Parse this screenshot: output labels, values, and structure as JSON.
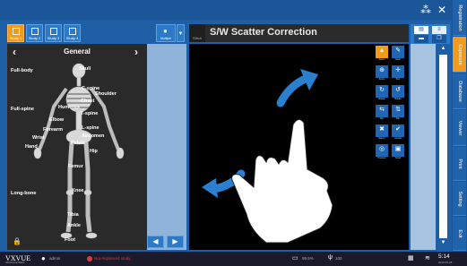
{
  "study_tabs": [
    "Study 1",
    "Study 2",
    "Study 3",
    "Study 4"
  ],
  "user_button": "Multiple",
  "bodymap": {
    "title": "General",
    "labels": [
      {
        "text": "Skull",
        "name": "skull"
      },
      {
        "text": "Full-body",
        "name": "full-body"
      },
      {
        "text": "C-spine",
        "name": "c-spine"
      },
      {
        "text": "Shoulder",
        "name": "shoulder"
      },
      {
        "text": "Chest",
        "name": "chest"
      },
      {
        "text": "Full-spine",
        "name": "full-spine"
      },
      {
        "text": "Humerus",
        "name": "humerus"
      },
      {
        "text": "T-spine",
        "name": "t-spine"
      },
      {
        "text": "Elbow",
        "name": "elbow"
      },
      {
        "text": "Forearm",
        "name": "forearm"
      },
      {
        "text": "L-spine",
        "name": "l-spine"
      },
      {
        "text": "Wrist",
        "name": "wrist"
      },
      {
        "text": "Abdomen",
        "name": "abdomen"
      },
      {
        "text": "Hand",
        "name": "hand"
      },
      {
        "text": "Pelvis",
        "name": "pelvis"
      },
      {
        "text": "Hip",
        "name": "hip"
      },
      {
        "text": "Femur",
        "name": "femur"
      },
      {
        "text": "Long-bone",
        "name": "long-bone"
      },
      {
        "text": "Knee",
        "name": "knee"
      },
      {
        "text": "Tibia",
        "name": "tibia"
      },
      {
        "text": "Ankle",
        "name": "ankle"
      },
      {
        "text": "Foot",
        "name": "foot"
      }
    ]
  },
  "viewer": {
    "title": "S/W Scatter Correction",
    "icon_label": "Stitch"
  },
  "tools": [
    {
      "label": "Select",
      "glyph": "▲",
      "active": true
    },
    {
      "label": "Mark",
      "glyph": "✎",
      "active": false
    },
    {
      "label": "Zoom",
      "glyph": "⊕",
      "active": false
    },
    {
      "label": "Pan",
      "glyph": "✛",
      "active": false
    },
    {
      "label": "Rotate",
      "glyph": "↻",
      "active": false
    },
    {
      "label": "Rotate",
      "glyph": "↺",
      "active": false
    },
    {
      "label": "Flip",
      "glyph": "⇆",
      "active": false
    },
    {
      "label": "Flip",
      "glyph": "⇅",
      "active": false
    },
    {
      "label": "Reject",
      "glyph": "✖",
      "active": false
    },
    {
      "label": "Accept",
      "glyph": "✔",
      "active": false
    },
    {
      "label": "Preview",
      "glyph": "◎",
      "active": false
    },
    {
      "label": "Send",
      "glyph": "▣",
      "active": false
    }
  ],
  "vertical_tabs": [
    {
      "label": "Registration",
      "active": false
    },
    {
      "label": "Exposure",
      "active": true
    },
    {
      "label": "Database",
      "active": false
    },
    {
      "label": "Viewer",
      "active": false
    },
    {
      "label": "Print",
      "active": false
    },
    {
      "label": "Setting",
      "active": false
    },
    {
      "label": "Exit",
      "active": false
    }
  ],
  "bottombar": {
    "logo": "VXVUE",
    "logo_sub": "IMAGING EXPERT",
    "user": "admin",
    "status": "Not-registered study",
    "battery": "99.5%",
    "signal": "100"
  },
  "clock": {
    "time": "5:14",
    "date": "2019-05-28"
  }
}
